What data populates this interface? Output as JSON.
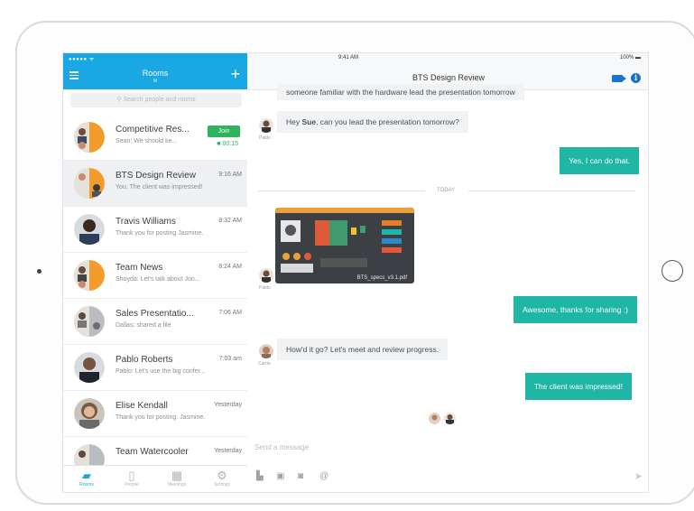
{
  "device": {
    "name": "iPad"
  },
  "left_pane": {
    "status": "●●●●● ᯤ",
    "title": "Rooms",
    "subtitle": "M",
    "add_label": "+",
    "search_placeholder": "Search people and rooms",
    "rooms": [
      {
        "name": "Competitive Res...",
        "message": "Sean: We should ke...",
        "time": "",
        "join_label": "Join",
        "call_time": "■ 00:15"
      },
      {
        "name": "BTS Design Review",
        "message": "You: The client was impressed!",
        "time": "9:16 AM"
      },
      {
        "name": "Travis Williams",
        "message": "Thank you for posting Jasmine.",
        "time": "8:32 AM"
      },
      {
        "name": "Team News",
        "message": "Shoyda: Let's talk about Jon...",
        "time": "8:24 AM"
      },
      {
        "name": "Sales Presentatio...",
        "message": "Dallas: shared a file",
        "time": "7:06 AM"
      },
      {
        "name": "Pablo Roberts",
        "message": "Pablo: Let's use the big confer...",
        "time": "7:03 am"
      },
      {
        "name": "Elise Kendall",
        "message": "Thank you for posting. Jasmine.",
        "time": "Yesterday"
      },
      {
        "name": "Team Watercooler",
        "message": "",
        "time": "Yesterday"
      }
    ],
    "tabs": [
      {
        "label": "Rooms",
        "icon": "rooms-icon"
      },
      {
        "label": "People",
        "icon": "people-icon"
      },
      {
        "label": "Meetings",
        "icon": "meetings-icon"
      },
      {
        "label": "Settings",
        "icon": "settings-icon"
      }
    ]
  },
  "right_pane": {
    "status_time": "9:41 AM",
    "battery": "100% ▬",
    "title": "BTS Design Review",
    "messages": {
      "m1": "someone familiar with the hardware lead the presentation tomorrow",
      "m2_pre": "Hey ",
      "m2_name": "Sue",
      "m2_post": ", can you lead the presentation tomorrow?",
      "m2_sender": "Pablo",
      "m3": "Yes, I can do that.",
      "divider": "TODAY",
      "file_name": "BTS_specs_v3.1.pdf",
      "file_sender": "Pablo",
      "m4": "Awesome, thanks for sharing :)",
      "m5": "How'd it go? Let's meet and review progress.",
      "m5_sender": "Carrie",
      "m6": "The client was impressed!"
    },
    "compose_placeholder": "Send a message"
  },
  "colors": {
    "accent": "#19a8e3",
    "outgoing": "#1fb6a6",
    "join": "#2fb25c",
    "header_icons": "#1b72d1"
  }
}
